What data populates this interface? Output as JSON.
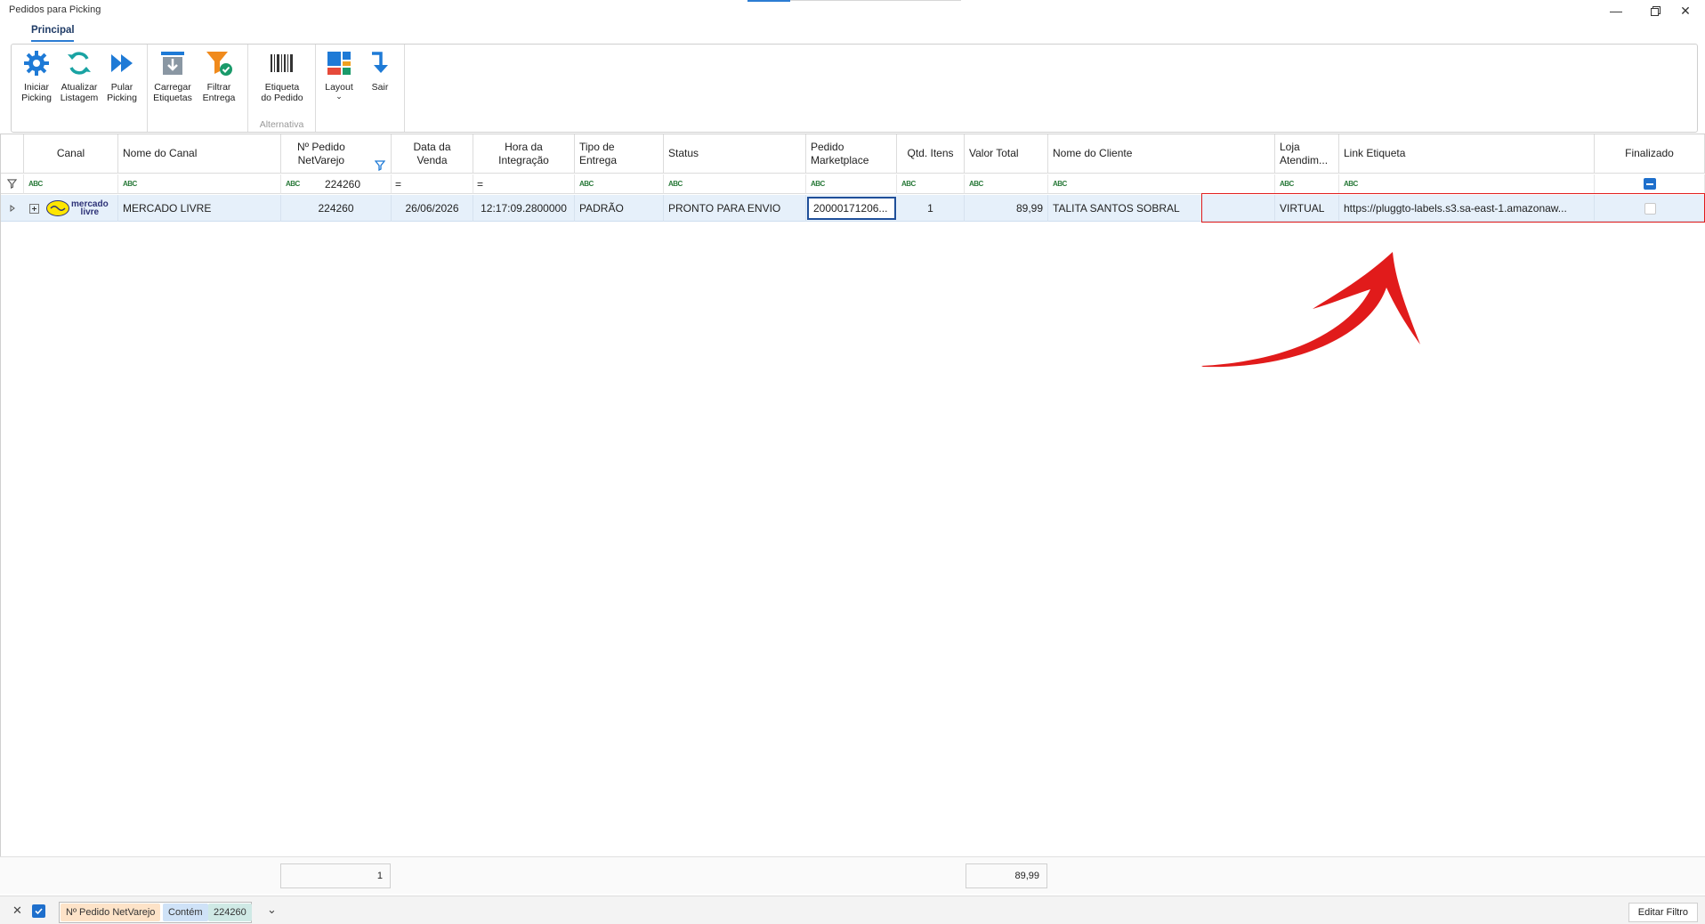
{
  "window": {
    "title": "Pedidos para Picking"
  },
  "ribbon": {
    "tab": "Principal",
    "buttons": {
      "iniciar": "Iniciar\nPicking",
      "atualizar": "Atualizar\nListagem",
      "pular": "Pular\nPicking",
      "carregar": "Carregar\nEtiquetas",
      "filtrar": "Filtrar\nEntrega",
      "etiqueta": "Etiqueta\ndo Pedido",
      "layout": "Layout",
      "sair": "Sair"
    },
    "group_alternativa": "Alternativa"
  },
  "grid": {
    "headers": {
      "canal": "Canal",
      "nome_canal": "Nome do Canal",
      "pedido_netvarejo": "Nº Pedido\nNetVarejo",
      "data_venda": "Data da\nVenda",
      "hora_integracao": "Hora da\nIntegração",
      "tipo_entrega": "Tipo de\nEntrega",
      "status": "Status",
      "pedido_marketplace": "Pedido\nMarketplace",
      "qtd_itens": "Qtd. Itens",
      "valor_total": "Valor Total",
      "nome_cliente": "Nome do Cliente",
      "loja_atendimento": "Loja\nAtendim...",
      "link_etiqueta": "Link Etiqueta",
      "finalizado": "Finalizado"
    },
    "filter_row": {
      "abc_icon": "abc-filter-icon",
      "pedido_value": "224260",
      "equals": "="
    },
    "rows": [
      {
        "logo_text_1": "mercado",
        "logo_text_2": "livre",
        "nome_canal": "MERCADO LIVRE",
        "pedido_netvarejo": "224260",
        "data_venda": "26/06/2026",
        "hora_integracao": "12:17:09.2800000",
        "tipo_entrega": "PADRÃO",
        "status": "PRONTO PARA ENVIO",
        "pedido_marketplace": "20000171206...",
        "qtd_itens": "1",
        "valor_total": "89,99",
        "nome_cliente": "TALITA SANTOS SOBRAL",
        "loja_atendimento": "VIRTUAL",
        "link_etiqueta": "https://pluggto-labels.s3.sa-east-1.amazonaw..."
      }
    ],
    "summary": {
      "count": "1",
      "total": "89,99"
    }
  },
  "filterbar": {
    "field": "Nº Pedido NetVarejo",
    "operator": "Contém",
    "value": "224260",
    "edit_label": "Editar Filtro"
  },
  "colors": {
    "accent": "#2b7cd3",
    "annotation_red": "#e11b1b",
    "row_selected": "#e6f0fa"
  }
}
